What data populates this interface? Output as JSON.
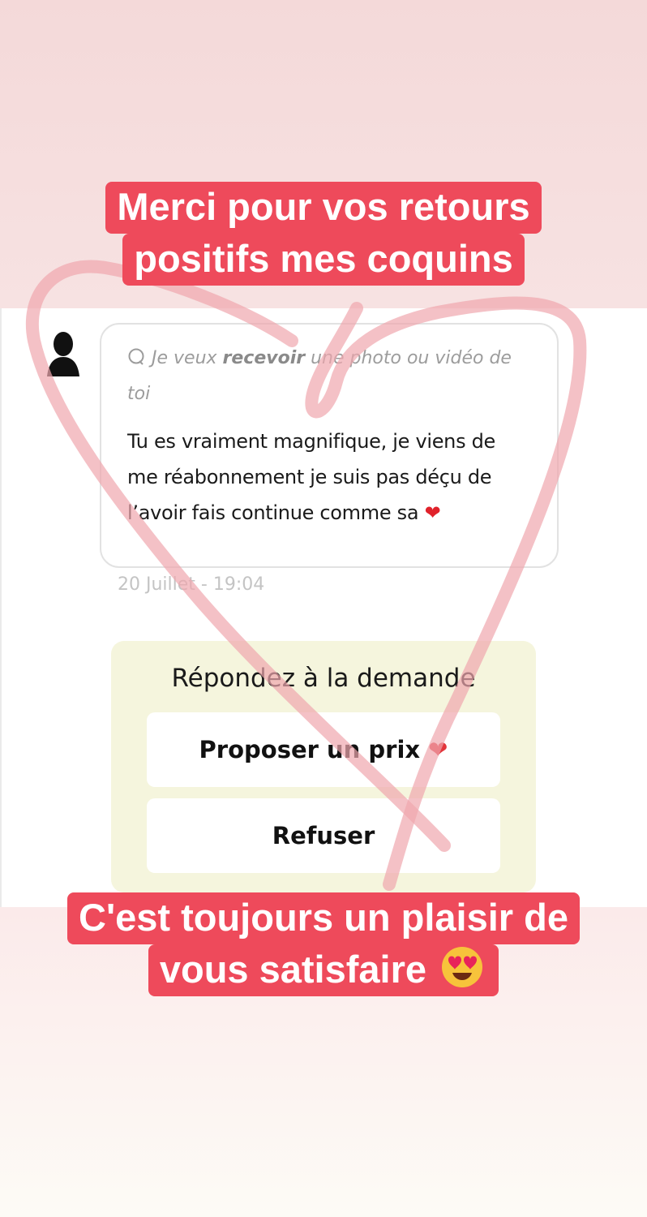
{
  "captions": {
    "top_line1": "Merci pour vos retours",
    "top_line2": "positifs mes coquins",
    "bottom_line1": "C'est toujours un plaisir de",
    "bottom_line2": "vous satisfaire"
  },
  "message_card": {
    "request_prefix": "Je veux ",
    "request_bold": "recevoir",
    "request_suffix": " une photo ou vidéo de toi",
    "message": "Tu es vraiment magnifique, je viens de me réabonnement je suis pas déçu de l’avoir fais continue comme sa",
    "heart": "❤",
    "timestamp": "20 Juillet - 19:04"
  },
  "reply": {
    "title": "Répondez à la demande",
    "propose_label": "Proposer un prix",
    "propose_heart": "❤",
    "refuse_label": "Refuser"
  },
  "colors": {
    "caption_bg": "#ee4a5b",
    "reply_bg": "#f5f5dd",
    "heart_overlay": "#f0a6ae"
  },
  "icons": [
    "chat-bubble-icon",
    "avatar-silhouette",
    "heart-icon",
    "heart-eyes-emoji",
    "heart-drawing"
  ]
}
